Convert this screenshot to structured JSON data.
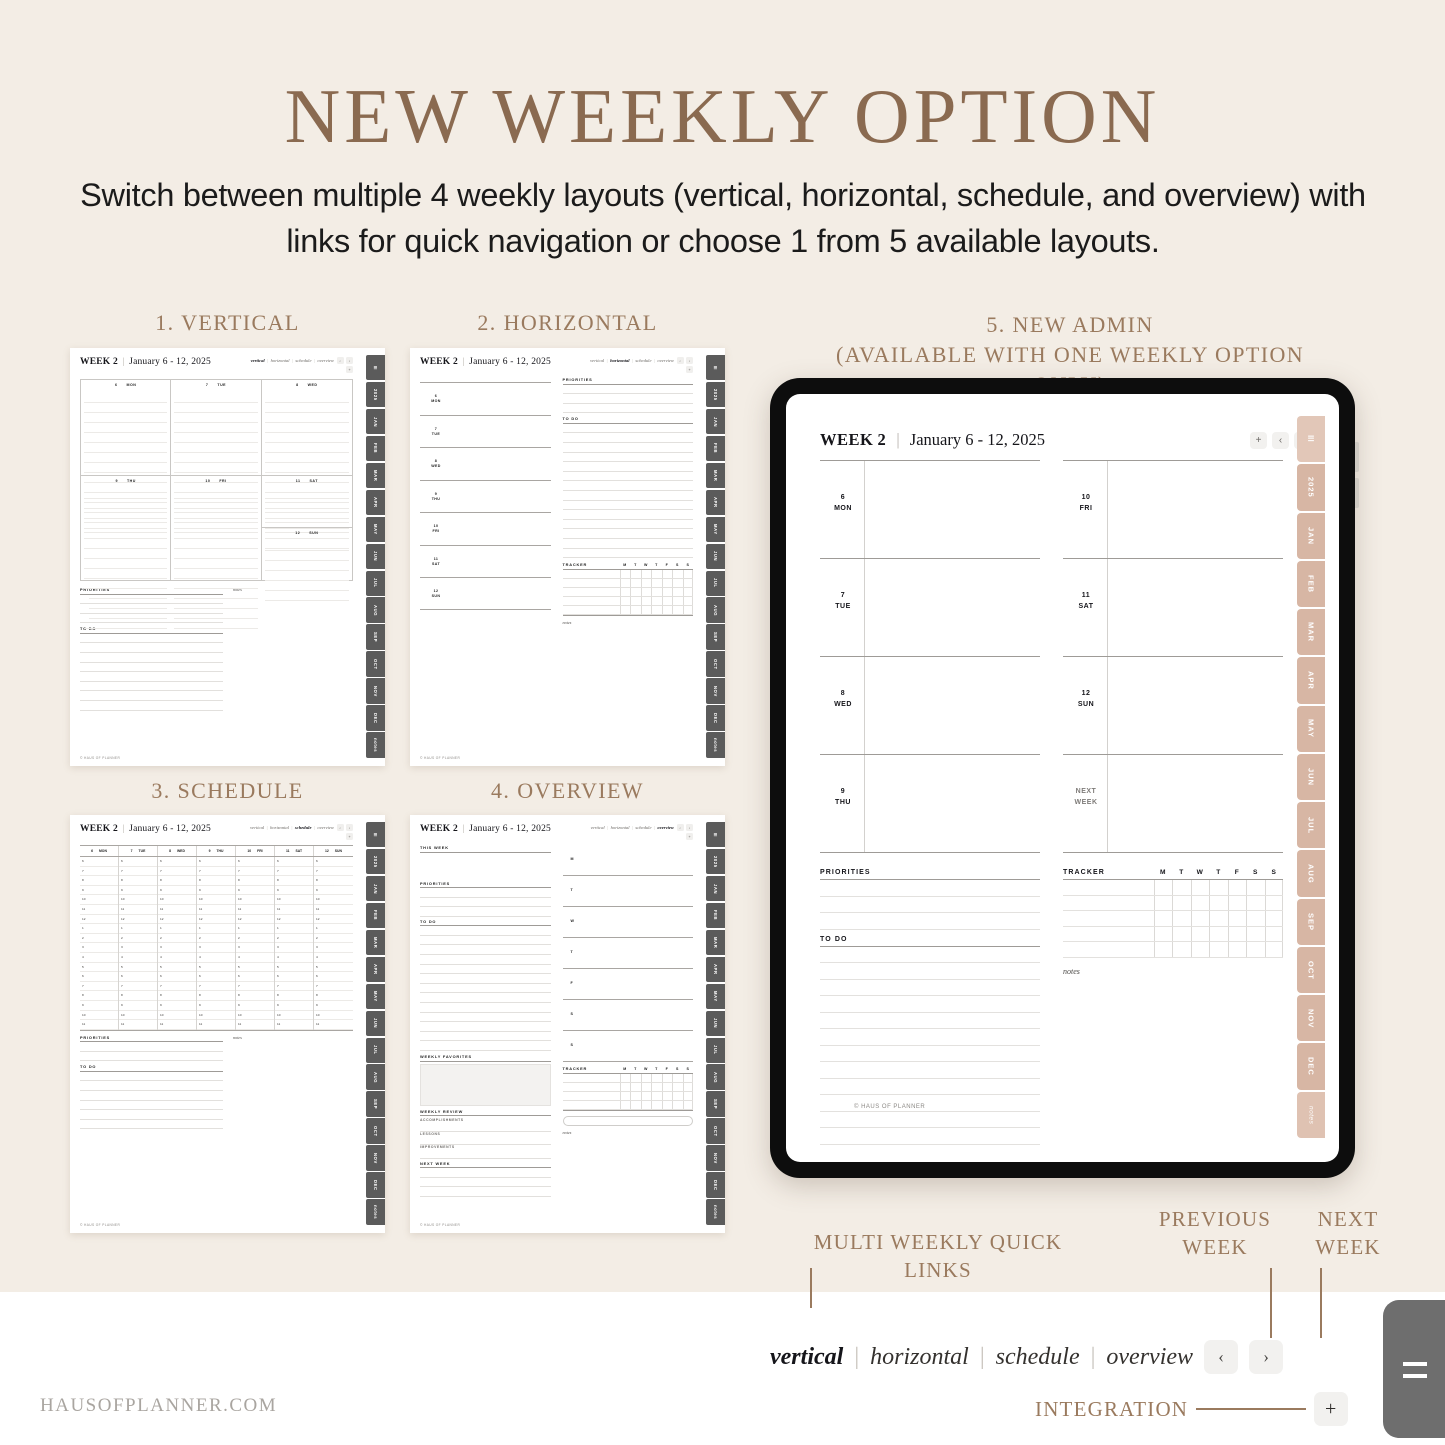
{
  "headline": "NEW WEEKLY OPTION",
  "subhead": "Switch between multiple 4 weekly layouts (vertical, horizontal, schedule, and overview) with links for quick navigation or choose 1 from 5 available layouts.",
  "captions": {
    "vertical": "1. VERTICAL",
    "horizontal": "2. HORIZONTAL",
    "schedule": "3. SCHEDULE",
    "overview": "4. OVERVIEW",
    "admin_line1": "5. NEW ADMIN",
    "admin_line2": "(AVAILABLE WITH ONE WEEKLY OPTION ONLY)"
  },
  "page_header": {
    "week_label": "WEEK",
    "week_number": "2",
    "separator": "|",
    "date_range": "January 6 - 12, 2025"
  },
  "quick_links": {
    "items": [
      "vertical",
      "horizontal",
      "schedule",
      "overview"
    ],
    "prev_icon": "‹",
    "next_icon": "›",
    "plus_icon": "+",
    "active_vertical": "vertical",
    "active_horizontal": "horizontal",
    "active_schedule": "schedule",
    "active_overview": "overview"
  },
  "days": [
    {
      "num": "6",
      "name": "MON"
    },
    {
      "num": "7",
      "name": "TUE"
    },
    {
      "num": "8",
      "name": "WED"
    },
    {
      "num": "9",
      "name": "THU"
    },
    {
      "num": "10",
      "name": "FRI"
    },
    {
      "num": "11",
      "name": "SAT"
    },
    {
      "num": "12",
      "name": "SUN"
    }
  ],
  "next_week_label_1": "NEXT",
  "next_week_label_2": "WEEK",
  "sections": {
    "priorities": "PRIORITIES",
    "to_do": "TO DO",
    "tracker": "TRACKER",
    "notes": "notes",
    "this_week": "THIS WEEK",
    "weekly_favorites": "WEEKLY FAVORITES",
    "weekly_review": "WEEKLY REVIEW",
    "accomplishments": "ACCOMPLISHMENTS",
    "lessons": "LESSONS",
    "improvements": "IMPROVEMENTS",
    "next_week": "NEXT WEEK"
  },
  "tracker_days": [
    "M",
    "T",
    "W",
    "T",
    "F",
    "S",
    "S"
  ],
  "schedule_hours": [
    "6",
    "7",
    "8",
    "9",
    "10",
    "11",
    "12",
    "1",
    "2",
    "3",
    "4",
    "5",
    "6",
    "7",
    "8",
    "9",
    "10",
    "11"
  ],
  "month_tabs": [
    "☰",
    "2025",
    "JAN",
    "FEB",
    "MAR",
    "APR",
    "MAY",
    "JUN",
    "JUL",
    "AUG",
    "SEP",
    "OCT",
    "NOV",
    "DEC",
    "notes"
  ],
  "tablet_controls": {
    "plus": "+",
    "prev": "‹",
    "next": "›"
  },
  "page_footer": "© HAUS OF PLANNER",
  "callouts": {
    "multi_links_1": "MULTI WEEKLY QUICK LINKS",
    "previous_week_1": "PREVIOUS",
    "previous_week_2": "WEEK",
    "next_week_1": "NEXT",
    "next_week_2": "WEEK"
  },
  "integration": {
    "label": "INTEGRATION",
    "button": "+"
  },
  "site_footer": "HAUSOFPLANNER.COM",
  "colors": {
    "background": "#f3ede5",
    "accent_brown": "#9a7a5e",
    "title_brown": "#8a6a50",
    "tab_pink": "#d7b6a4",
    "tab_gray": "#5b5b5b",
    "device_black": "#0d0d0d"
  }
}
